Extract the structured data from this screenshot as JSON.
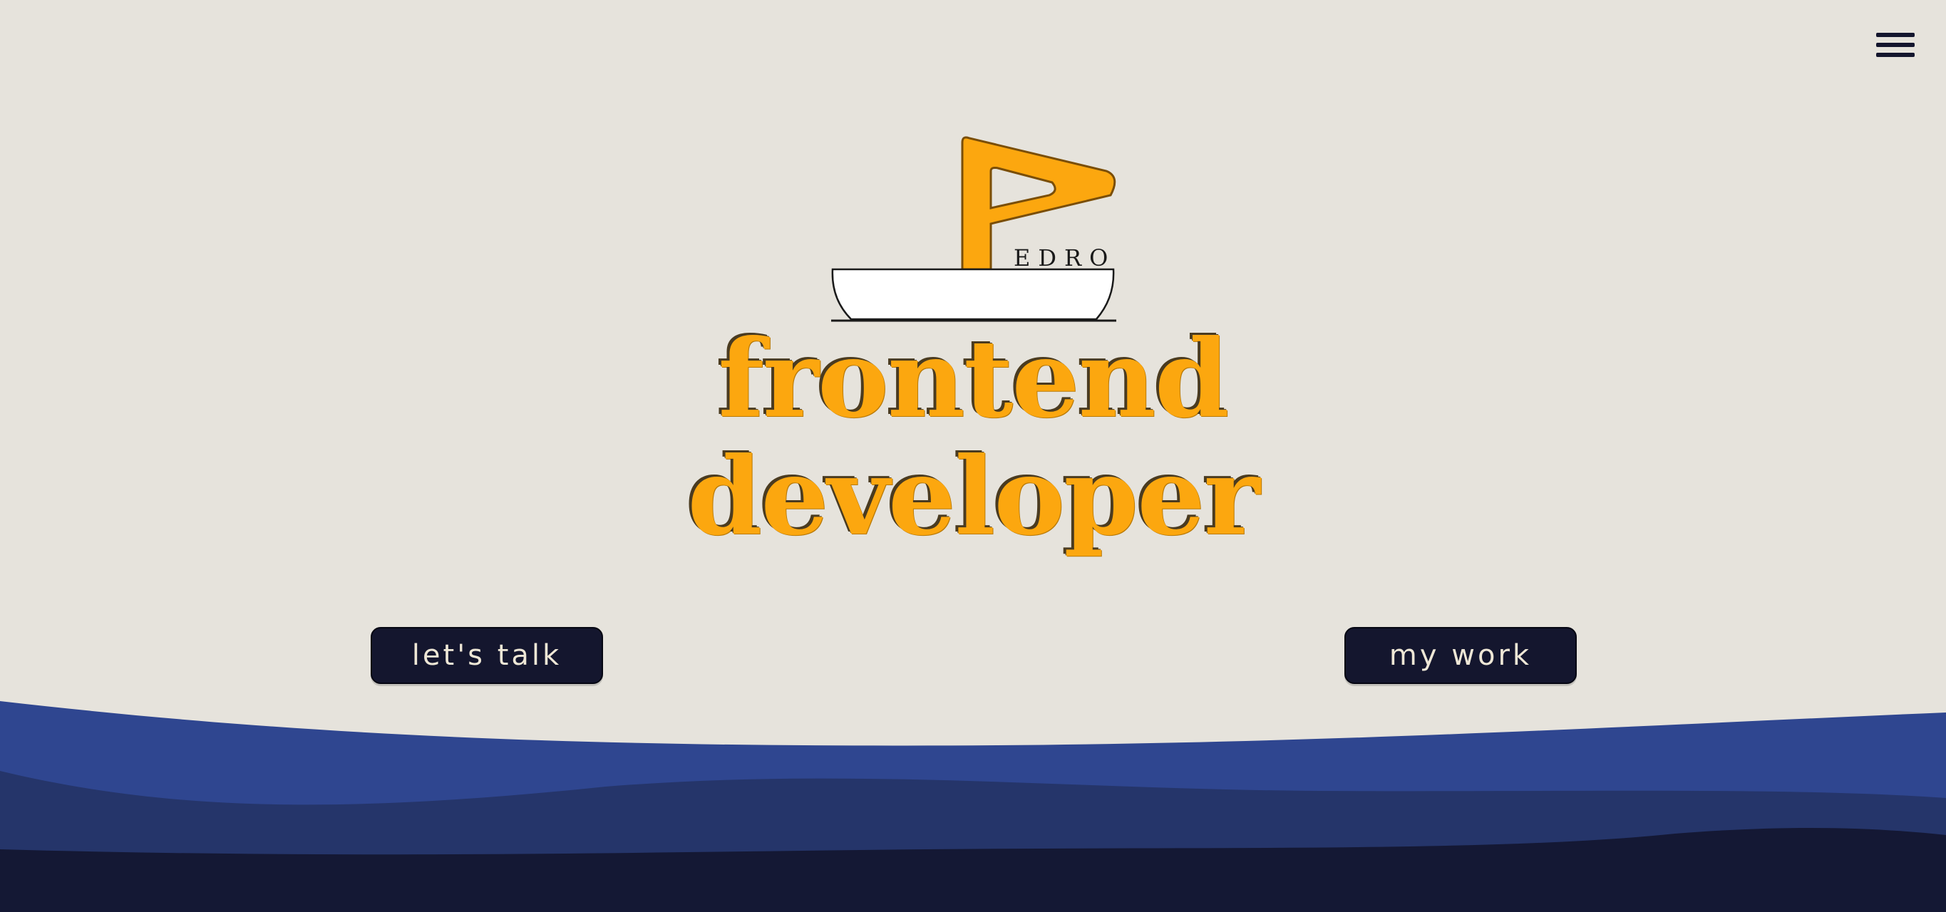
{
  "header": {
    "menu_icon": "hamburger-menu-icon"
  },
  "logo": {
    "initial": "P",
    "name_rest": "EDRO",
    "icon": "boat-flag-logo-icon"
  },
  "hero": {
    "line1": "frontend",
    "line2": "developer"
  },
  "actions": {
    "talk_label": "let's talk",
    "work_label": "my work"
  },
  "colors": {
    "background": "#e6e3dc",
    "accent": "#fca70f",
    "button": "#14162e",
    "wave_light": "#2f4690",
    "wave_mid": "#25356a",
    "wave_dark": "#141834"
  }
}
